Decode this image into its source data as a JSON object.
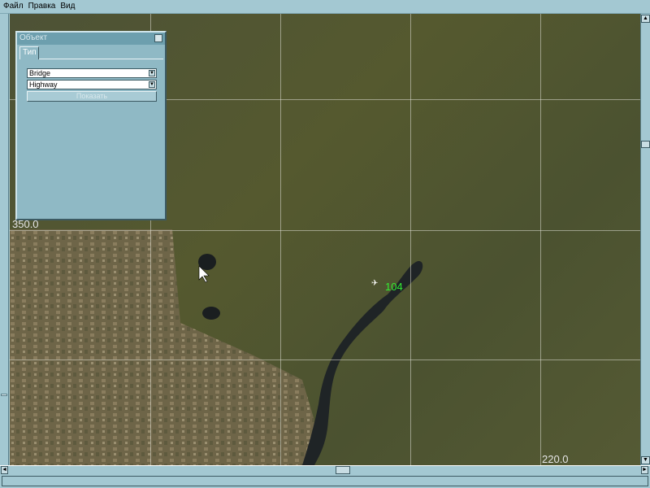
{
  "menu": [
    "Файл",
    "Правка",
    "Вид"
  ],
  "panel": {
    "title": "Объект",
    "close": "✕",
    "tab": "Тип",
    "type_value": "Bridge",
    "subtype_value": "Highway",
    "show_button": "Показать",
    "dropdown_icon": "▼"
  },
  "map": {
    "coord_top_left": "350.0",
    "coord_bottom_right": "220.0",
    "marker_label": "104",
    "marker_icon": "aircraft-icon",
    "marker_color": "#33ee33"
  },
  "scroll": {
    "up": "▲",
    "down": "▼",
    "left": "◄",
    "right": "►"
  }
}
